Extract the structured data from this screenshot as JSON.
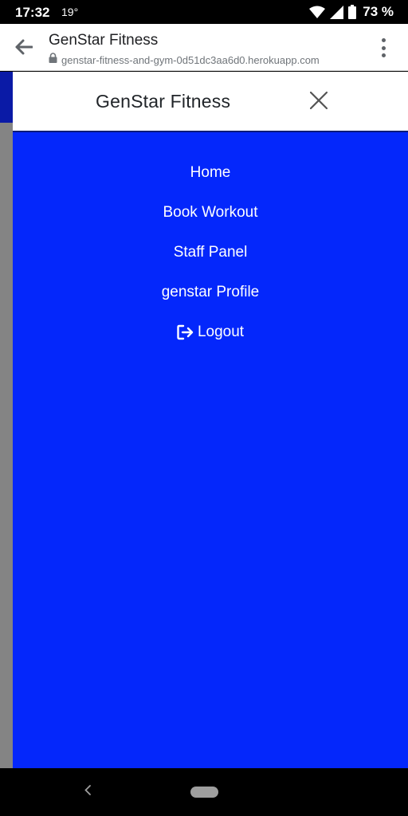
{
  "status_bar": {
    "time": "17:32",
    "temperature": "19°",
    "battery_percent": "73 %",
    "icons": [
      "wifi-icon",
      "signal-icon",
      "battery-icon"
    ]
  },
  "browser": {
    "page_title": "GenStar Fitness",
    "url": "genstar-fitness-and-gym-0d51dc3aa6d0.herokuapp.com",
    "icons": [
      "back-arrow-icon",
      "lock-icon",
      "more-vert-icon"
    ]
  },
  "drawer": {
    "title": "GenStar Fitness",
    "close_icon": "close-icon",
    "nav_items": [
      {
        "label": "Home"
      },
      {
        "label": "Book Workout"
      },
      {
        "label": "Staff Panel"
      },
      {
        "label": "genstar Profile"
      },
      {
        "label": "Logout",
        "icon": "logout-icon"
      }
    ]
  },
  "colors": {
    "drawer_background": "#0427fb",
    "header_background": "#ffffff",
    "status_bar": "#000000"
  }
}
